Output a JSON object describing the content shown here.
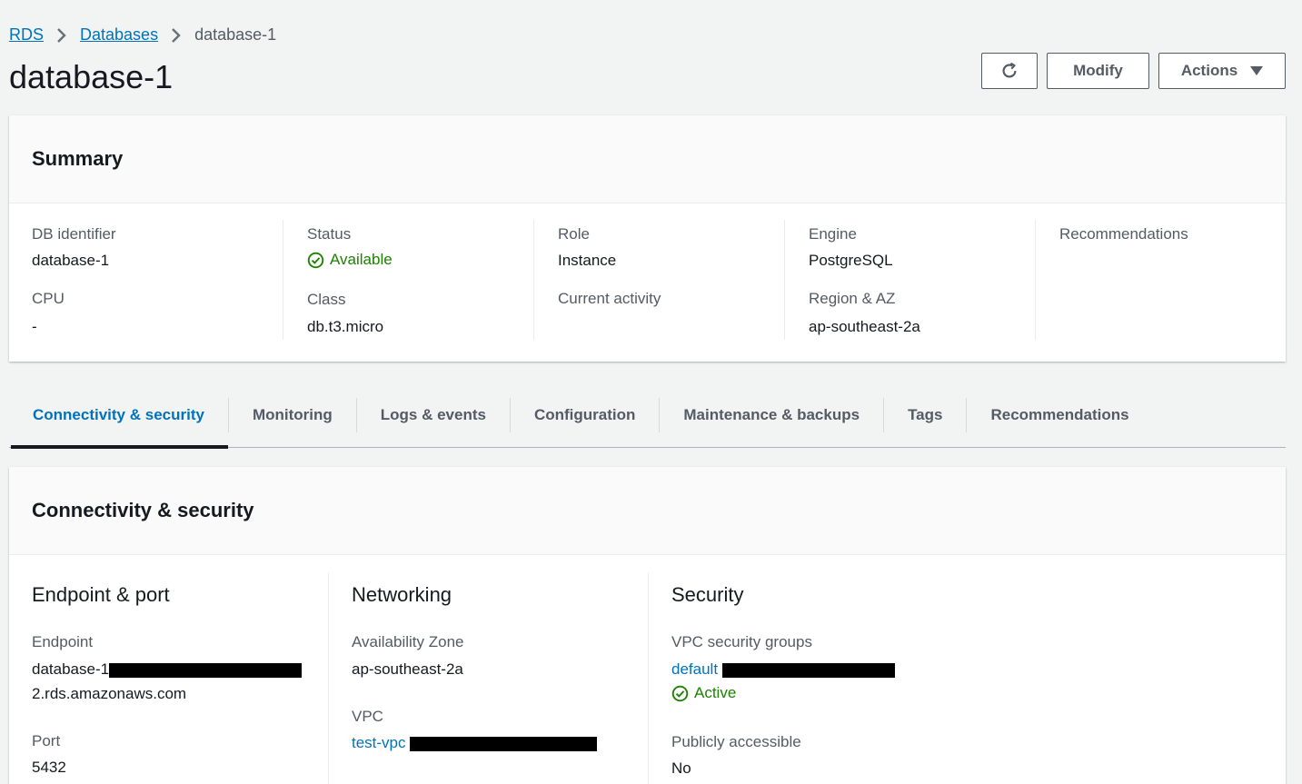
{
  "breadcrumb": {
    "items": [
      "RDS",
      "Databases"
    ],
    "current": "database-1"
  },
  "page": {
    "title": "database-1"
  },
  "header_actions": {
    "refresh_icon": "refresh-icon",
    "modify_label": "Modify",
    "actions_label": "Actions"
  },
  "summary": {
    "title": "Summary",
    "db_identifier_label": "DB identifier",
    "db_identifier": "database-1",
    "cpu_label": "CPU",
    "cpu": "-",
    "status_label": "Status",
    "status": "Available",
    "class_label": "Class",
    "class": "db.t3.micro",
    "role_label": "Role",
    "role": "Instance",
    "current_activity_label": "Current activity",
    "engine_label": "Engine",
    "engine": "PostgreSQL",
    "region_label": "Region & AZ",
    "region": "ap-southeast-2a",
    "recommendations_label": "Recommendations"
  },
  "tabs": [
    "Connectivity & security",
    "Monitoring",
    "Logs & events",
    "Configuration",
    "Maintenance & backups",
    "Tags",
    "Recommendations"
  ],
  "connectivity": {
    "title": "Connectivity & security",
    "endpoint_port": {
      "heading": "Endpoint & port",
      "endpoint_label": "Endpoint",
      "endpoint_prefix": "database-1",
      "endpoint_suffix": "2.rds.amazonaws.com",
      "port_label": "Port",
      "port": "5432"
    },
    "networking": {
      "heading": "Networking",
      "az_label": "Availability Zone",
      "az": "ap-southeast-2a",
      "vpc_label": "VPC",
      "vpc_link": "test-vpc"
    },
    "security": {
      "heading": "Security",
      "sg_label": "VPC security groups",
      "sg_link": "default",
      "sg_status": "Active",
      "public_label": "Publicly accessible",
      "public": "No"
    }
  },
  "colors": {
    "link": "#0073bb",
    "success": "#1d8102",
    "background": "#f2f3f3"
  }
}
